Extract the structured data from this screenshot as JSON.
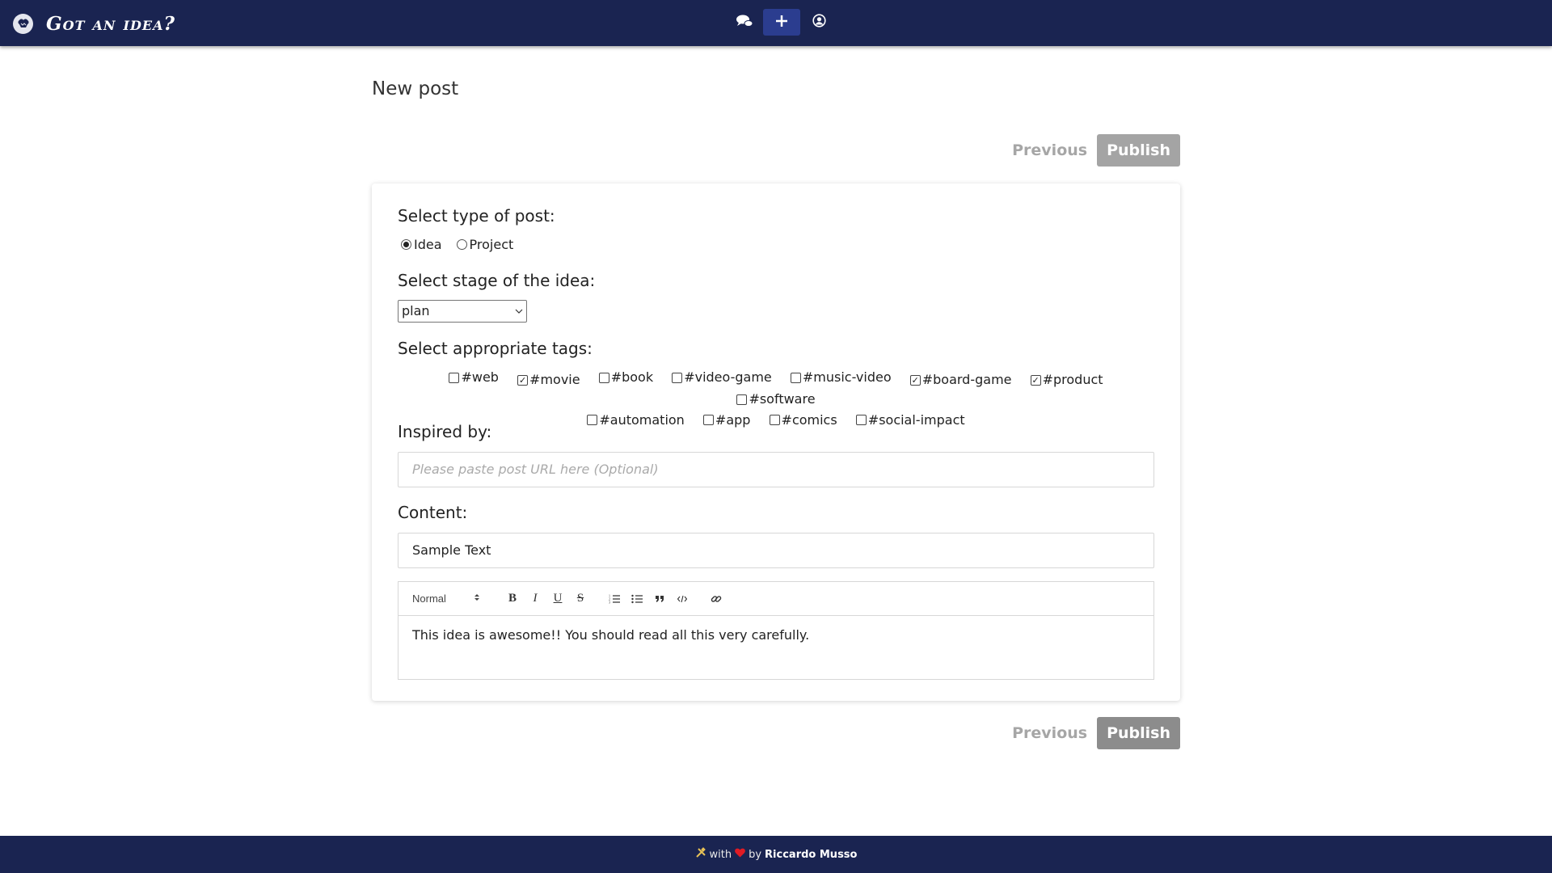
{
  "navbar": {
    "title": "Got an idea?",
    "icons": [
      "brain-logo-icon",
      "chat-bubbles-icon",
      "plus-icon",
      "user-circle-icon"
    ]
  },
  "page": {
    "title": "New post"
  },
  "actions": {
    "previous_label": "Previous",
    "publish_label": "Publish"
  },
  "form": {
    "type_label": "Select type of post:",
    "type_options": [
      {
        "label": "Idea",
        "checked": true
      },
      {
        "label": "Project",
        "checked": false
      }
    ],
    "stage_label": "Select stage of the idea:",
    "stage_value": "plan",
    "tags_label": "Select appropriate tags:",
    "tags": [
      {
        "label": "#web",
        "checked": false
      },
      {
        "label": "#movie",
        "checked": true
      },
      {
        "label": "#book",
        "checked": false
      },
      {
        "label": "#video-game",
        "checked": false
      },
      {
        "label": "#music-video",
        "checked": false
      },
      {
        "label": "#board-game",
        "checked": true
      },
      {
        "label": "#product",
        "checked": true
      },
      {
        "label": "#software",
        "checked": false
      },
      {
        "label": "#automation",
        "checked": false
      },
      {
        "label": "#app",
        "checked": false
      },
      {
        "label": "#comics",
        "checked": false
      },
      {
        "label": "#social-impact",
        "checked": false
      }
    ],
    "inspired_label": "Inspired by:",
    "inspired_placeholder": "Please paste post URL here (Optional)",
    "content_label": "Content:",
    "content_title_value": "Sample Text",
    "editor": {
      "format_value": "Normal",
      "body": "This idea is awesome!! You should read all this very carefully."
    }
  },
  "footer": {
    "with": "with",
    "by": "by",
    "author": "Riccardo Musso",
    "heart_color": "#e01b24"
  },
  "colors": {
    "navbar": "#1a2451",
    "active_nav": "#2b3d8f"
  }
}
